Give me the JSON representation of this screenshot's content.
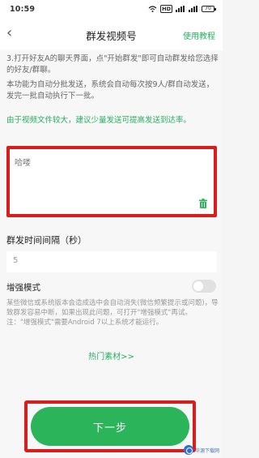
{
  "status_bar": {
    "time": "10:59",
    "battery": "70"
  },
  "nav": {
    "title": "群发视频号",
    "action": "使用教程"
  },
  "tips": {
    "step3": "3.打开好友A的聊天界面，点\"开始群发\"即可自动群发给您选择的好友/群聊。",
    "auto_batch": "本功能为自动分批发送，系统会自动每次按9人/群自动发送，发完一批自动执行下一批。",
    "size_notice": "由于视频文件较大，建议少量发送可提高发送到达率。"
  },
  "message": {
    "text": "哈喽"
  },
  "interval": {
    "label": "群发时间间隔（秒）",
    "value": "5"
  },
  "enhance": {
    "label": "增强模式",
    "desc_1": "某些微信或系统版本会造成选中会自动消失(微信频繁提示或问题)，导致群发容易中断，如果出现此问题，可打开\"增强模式\"再试。",
    "desc_2": "注：\"增强模式\"需要Android 7以上系统才能运行。"
  },
  "hot_link": "热门素材>>",
  "next_button": "下一步",
  "watermark": {
    "text": "华源下载网"
  },
  "colors": {
    "accent": "#2bb45a",
    "highlight": "#d91c1c"
  }
}
